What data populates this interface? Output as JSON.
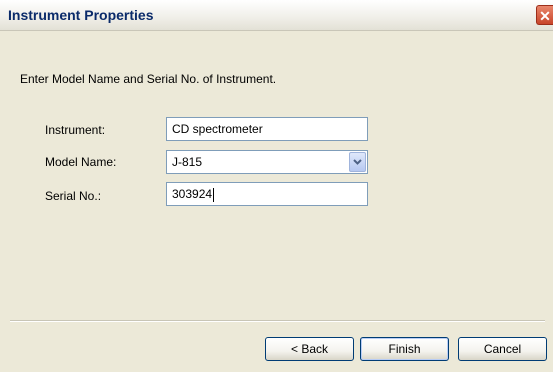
{
  "window": {
    "title": "Instrument Properties",
    "close_symbol": "✕"
  },
  "instruction": "Enter Model Name and Serial No. of Instrument.",
  "form": {
    "instrument": {
      "label": "Instrument:",
      "value": "CD spectrometer"
    },
    "model_name": {
      "label": "Model Name:",
      "value": "J-815"
    },
    "serial_no": {
      "label": "Serial No.:",
      "value": "303924"
    }
  },
  "buttons": {
    "back": "< Back",
    "finish": "Finish",
    "cancel": "Cancel"
  },
  "icons": {
    "close": "close-icon",
    "dropdown": "chevron-down-icon"
  },
  "colors": {
    "title_text": "#0b2b6a",
    "close_button": "#c8452a",
    "input_border": "#7f9db9",
    "dialog_background": "#ece9d8"
  }
}
